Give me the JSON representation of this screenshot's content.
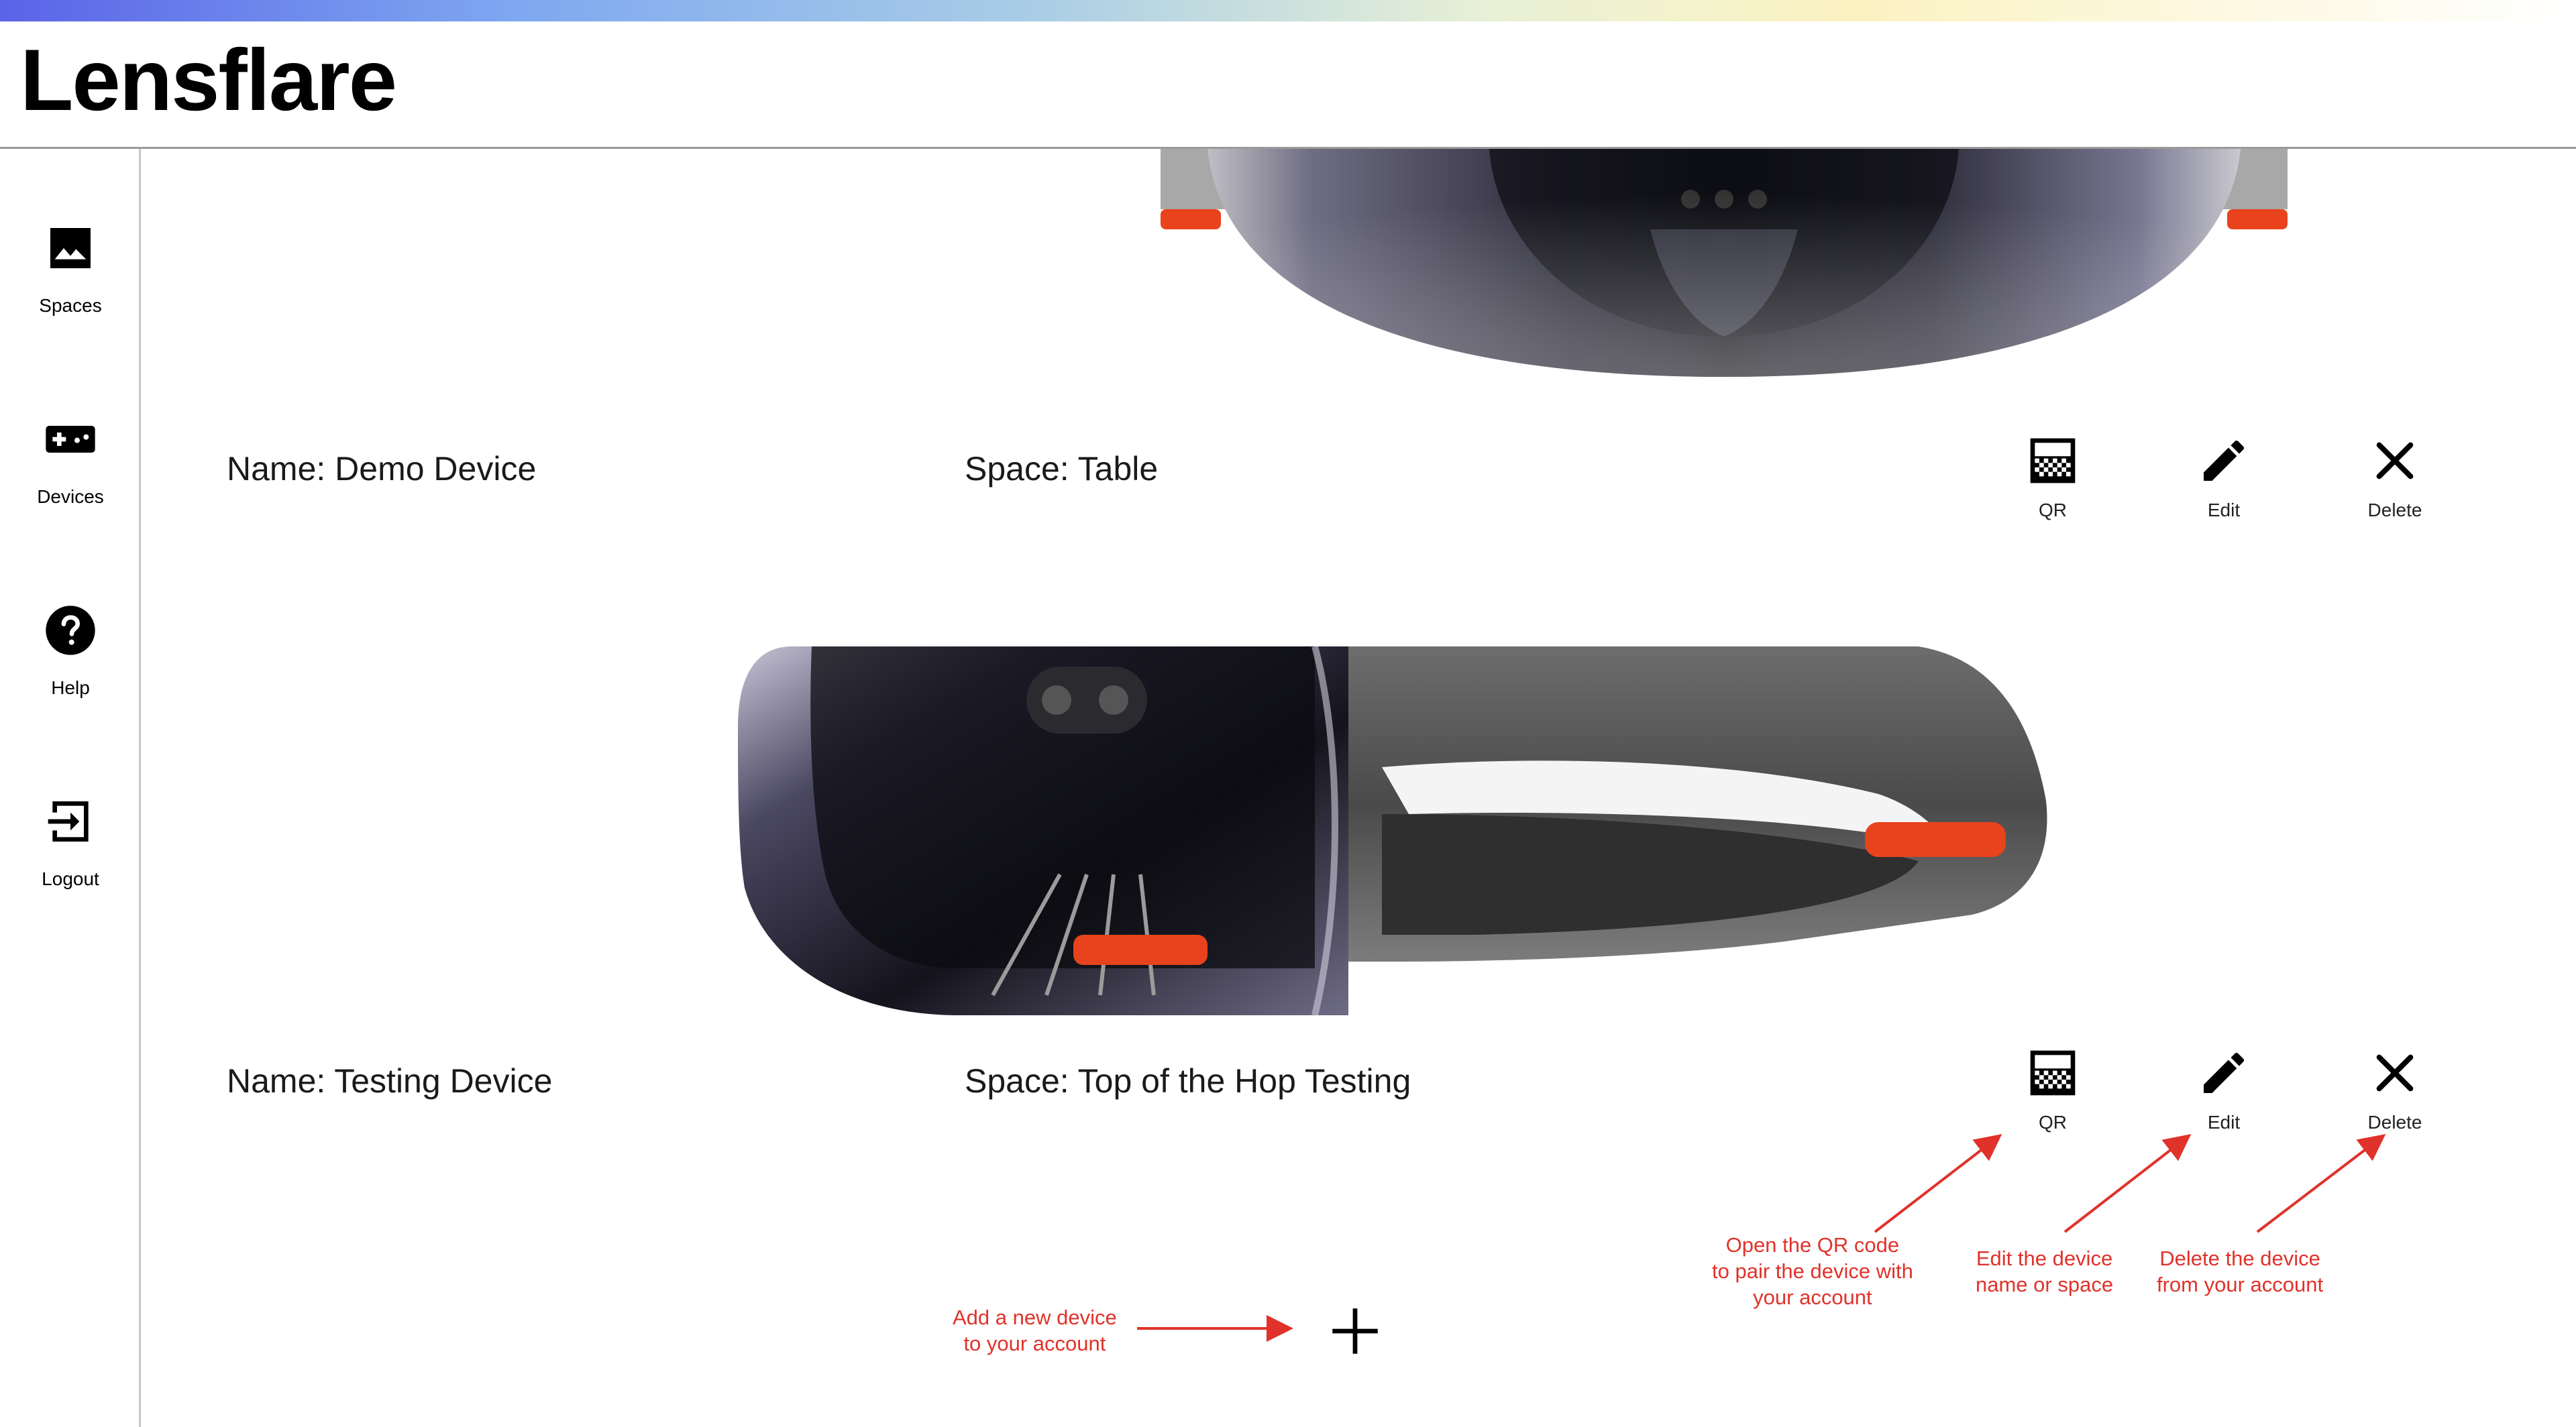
{
  "app": {
    "title": "Lensflare"
  },
  "sidebar": {
    "items": [
      {
        "label": "Spaces",
        "icon": "image-icon"
      },
      {
        "label": "Devices",
        "icon": "gamepad-icon"
      },
      {
        "label": "Help",
        "icon": "help-icon"
      },
      {
        "label": "Logout",
        "icon": "logout-icon"
      }
    ]
  },
  "devices": [
    {
      "name": "Name: Demo Device",
      "space": "Space: Table",
      "actions": {
        "qr": "QR",
        "edit": "Edit",
        "delete": "Delete"
      }
    },
    {
      "name": "Name: Testing Device",
      "space": "Space: Top of the Hop Testing",
      "actions": {
        "qr": "QR",
        "edit": "Edit",
        "delete": "Delete"
      }
    }
  ],
  "add_button": {
    "icon": "plus-icon"
  },
  "annotations": {
    "qr": [
      "Open the QR code",
      "to pair the device with",
      "your account"
    ],
    "edit": [
      "Edit the device",
      "name or space"
    ],
    "delete": [
      "Delete the device",
      "from your account"
    ],
    "add": [
      "Add a new device",
      "to your account"
    ]
  },
  "colors": {
    "annotation": "#e0322a",
    "orange_accent": "#e8431c"
  }
}
